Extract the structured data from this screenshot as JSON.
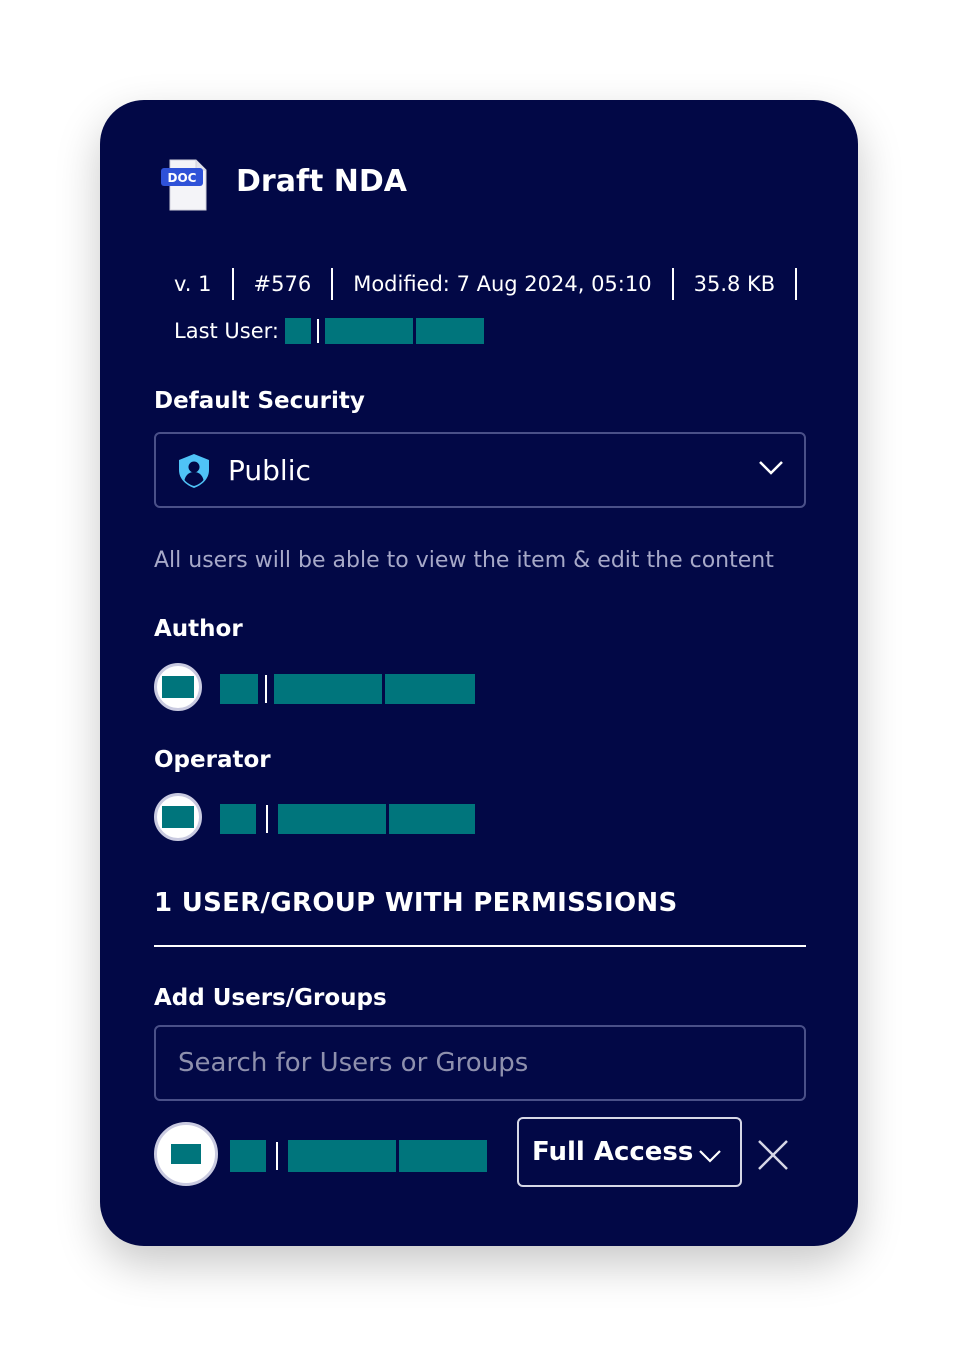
{
  "document": {
    "type_badge": "DOC",
    "title": "Draft NDA",
    "meta": [
      "v. 1",
      "#576",
      "Modified: 7 Aug 2024, 05:10",
      "35.8 KB"
    ],
    "last_user_label": "Last User:"
  },
  "security": {
    "section_label": "Default Security",
    "selected": "Public",
    "icon": "shield-user-icon",
    "description": "All users will be able to view the item & edit the content"
  },
  "author": {
    "label": "Author"
  },
  "operator": {
    "label": "Operator"
  },
  "permissions": {
    "heading": "1 USER/GROUP WITH PERMISSIONS",
    "add_label": "Add Users/Groups",
    "search_placeholder": "Search for Users or Groups",
    "access_level": "Full Access"
  },
  "colors": {
    "card_background": "#020846",
    "redacted": "#00757c",
    "shield": "#4fc3f7"
  }
}
